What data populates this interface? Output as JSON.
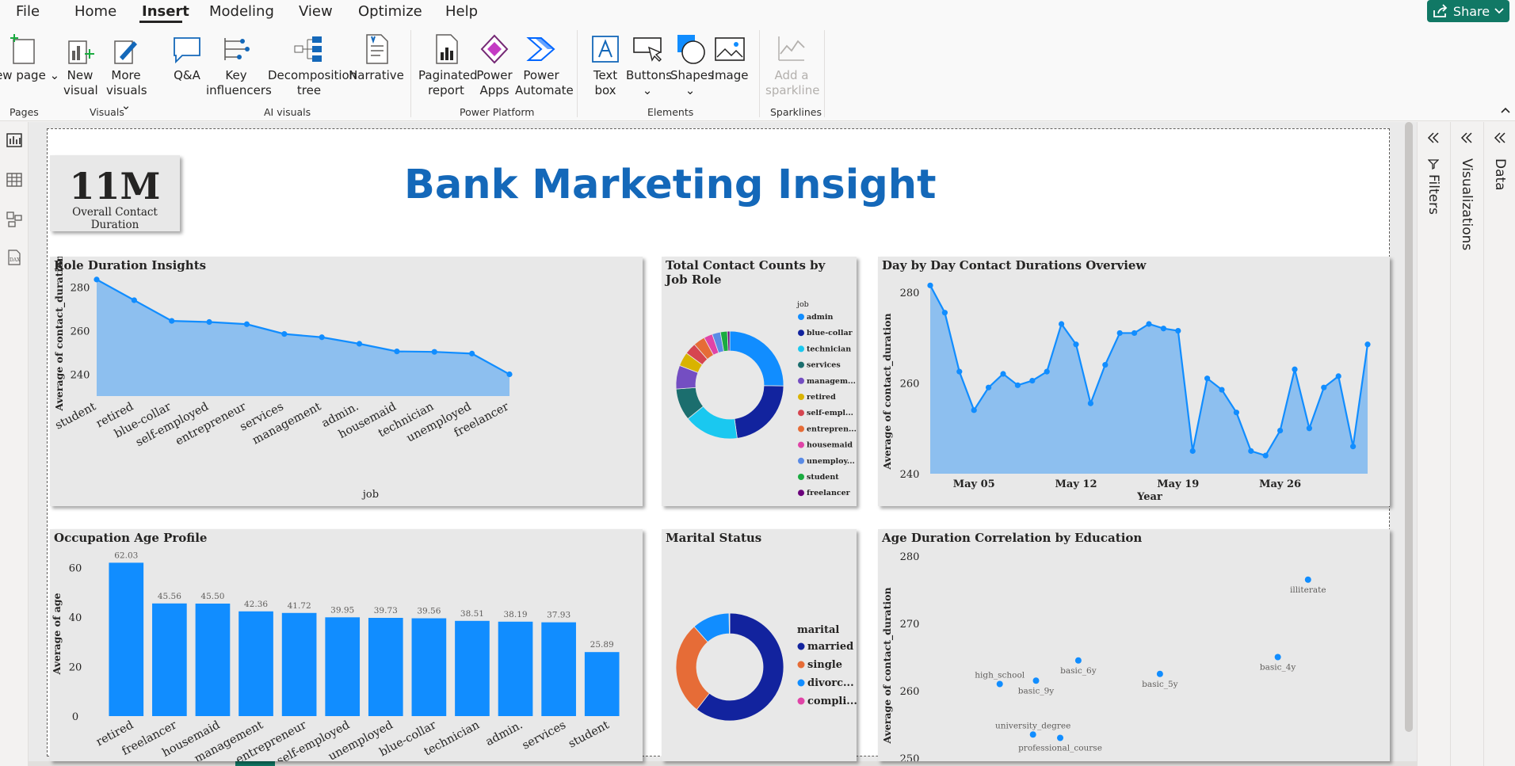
{
  "menu": {
    "items": [
      "File",
      "Home",
      "Insert",
      "Modeling",
      "View",
      "Optimize",
      "Help"
    ],
    "active": "Insert",
    "share_label": "Share"
  },
  "ribbon": {
    "new_page": "New page",
    "new_visual": "New visual",
    "more_visuals": "More visuals",
    "qa": "Q&A",
    "key_influencers": "Key influencers",
    "decomposition_tree": "Decomposition tree",
    "narrative": "Narrative",
    "paginated_report": "Paginated report",
    "power_apps": "Power Apps",
    "power_automate": "Power Automate",
    "text_box": "Text box",
    "buttons": "Buttons",
    "shapes": "Shapes",
    "image": "Image",
    "add_sparkline": "Add a sparkline",
    "groups": {
      "pages": "Pages",
      "visuals": "Visuals",
      "ai_visuals": "AI visuals",
      "power_platform": "Power Platform",
      "elements": "Elements",
      "sparklines": "Sparklines"
    }
  },
  "panes": {
    "filters": "Filters",
    "visualizations": "Visualizations",
    "data": "Data"
  },
  "report": {
    "title": "Bank Marketing Insight",
    "card": {
      "value": "11M",
      "label": "Overall Contact Duration"
    }
  },
  "colors": {
    "accent": "#118DFF",
    "area_fill": "#8DBFEF",
    "title_blue": "#1468B9",
    "share_green": "#117865"
  },
  "chart_data": [
    {
      "id": "role_duration",
      "type": "area",
      "title": "Role Duration Insights",
      "xlabel": "job",
      "ylabel": "Average of contact_duration",
      "categories": [
        "student",
        "retired",
        "blue-collar",
        "self-employed",
        "entrepreneur",
        "services",
        "management",
        "admin.",
        "housemaid",
        "technician",
        "unemployed",
        "freelancer"
      ],
      "values": [
        283.5,
        274,
        264.5,
        264,
        263,
        258.5,
        257,
        254,
        250.5,
        250.3,
        249.5,
        240
      ],
      "yticks": [
        240,
        260,
        280
      ],
      "ylim": [
        230,
        286
      ]
    },
    {
      "id": "contact_counts_job",
      "type": "pie",
      "title": "Total Contact Counts by Job Role",
      "legend_title": "job",
      "labels": [
        "admin",
        "blue-collar",
        "technician",
        "services",
        "managem...",
        "retired",
        "self-empl...",
        "entrepren...",
        "housemaid",
        "unemploy...",
        "student",
        "freelancer"
      ],
      "values": [
        25.3,
        22.5,
        16.4,
        9.6,
        7.1,
        4.2,
        3.5,
        3.5,
        2.6,
        2.5,
        2.1,
        0.7
      ],
      "colors": [
        "#118DFF",
        "#12239E",
        "#1AC8F0",
        "#1B6E6E",
        "#744EC2",
        "#D9B300",
        "#D64550",
        "#E66C37",
        "#E044A7",
        "#5A8BE6",
        "#1AAB40",
        "#6B007B"
      ]
    },
    {
      "id": "day_by_day",
      "type": "area",
      "title": "Day by Day Contact Durations Overview",
      "xlabel": "Year",
      "ylabel": "Average of contact_duration",
      "x_ticks": [
        "May 05",
        "May 12",
        "May 19",
        "May 26"
      ],
      "values": [
        281.5,
        275.5,
        262.5,
        254,
        259,
        262,
        259.5,
        260.5,
        262.5,
        273,
        268.5,
        255.5,
        264,
        271,
        271,
        273,
        272,
        271.5,
        245,
        261,
        258.5,
        253.5,
        245,
        244,
        249.5,
        263,
        250,
        259,
        261.5,
        246,
        268.5
      ],
      "yticks": [
        240,
        260,
        280
      ],
      "ylim": [
        240,
        284
      ]
    },
    {
      "id": "occupation_age",
      "type": "bar",
      "title": "Occupation Age Profile",
      "ylabel": "Average of age",
      "categories": [
        "retired",
        "freelancer",
        "housemaid",
        "management",
        "entrepreneur",
        "self-employed",
        "unemployed",
        "blue-collar",
        "technician",
        "admin.",
        "services",
        "student"
      ],
      "values": [
        62.03,
        45.56,
        45.5,
        42.36,
        41.72,
        39.95,
        39.73,
        39.56,
        38.51,
        38.19,
        37.93,
        25.89
      ],
      "yticks": [
        0,
        20,
        40,
        60
      ],
      "ylim": [
        0,
        66
      ]
    },
    {
      "id": "marital_status",
      "type": "pie",
      "title": "Marital Status",
      "legend_title": "marital",
      "labels": [
        "married",
        "single",
        "divorc...",
        "compli..."
      ],
      "values": [
        60.5,
        28,
        11.3,
        0.2
      ],
      "colors": [
        "#12239E",
        "#E66C37",
        "#118DFF",
        "#E044A7"
      ]
    },
    {
      "id": "age_duration_education",
      "type": "scatter",
      "title": "Age Duration Correlation by Education",
      "ylabel": "Average of contact_duration",
      "yticks": [
        250,
        260,
        270,
        280
      ],
      "ylim": [
        250,
        280
      ],
      "points": [
        {
          "label": "illiterate",
          "x": 48.5,
          "y": 276.5
        },
        {
          "label": "basic_4y",
          "x": 47.5,
          "y": 265
        },
        {
          "label": "basic_6y",
          "x": 40.9,
          "y": 264.5
        },
        {
          "label": "basic_5y",
          "x": 43.6,
          "y": 262.5
        },
        {
          "label": "high_school",
          "x": 38.3,
          "y": 261
        },
        {
          "label": "basic_9y",
          "x": 39.5,
          "y": 261.5
        },
        {
          "label": "university_degree",
          "x": 39.4,
          "y": 253.5
        },
        {
          "label": "professional_course",
          "x": 40.3,
          "y": 253
        }
      ],
      "xlim": [
        36,
        50
      ]
    }
  ]
}
